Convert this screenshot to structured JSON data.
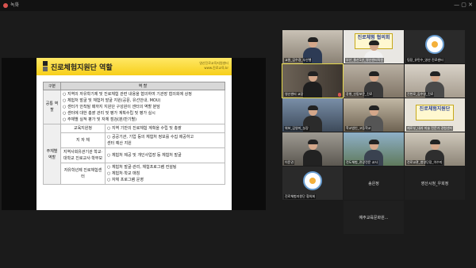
{
  "window": {
    "title": "녹화",
    "window_controls": "— ▢ ✕"
  },
  "slide": {
    "title": "진로체험지원단 역할",
    "org_line1": "영산진로교육지원센터",
    "org_line2": "www.진로교육.kr",
    "col_headers": [
      "구분",
      "역 할"
    ],
    "common": {
      "label": "공통 역할",
      "items": [
        "○ 지역의 자유학기제 및 진로체험 관련 내용을 협의하여 기관장 협의회에 상정",
        "○ 체험처 발굴 및 체험처 발굴 지원(공문, 유선안내, MOU)",
        "○ 센터가 안착될 때까지 지원단 구성원이 센터의 역할 분담",
        "○ 센터에 대한 총괄 관리 및 평가 계획수립 및 평가 실시",
        "○ 주체별 실적 평가 및 자체 점검(분/반기별)"
      ]
    },
    "agency": {
      "label": "주체별 역할",
      "rows": [
        {
          "sub": "교육지원청",
          "items": [
            "○ 지역 기반의 진로체험 계획을 수립 및 총괄"
          ]
        },
        {
          "sub": "지 자 체",
          "items": [
            "○ 공공기관, 기업 등의 체험처 정보를 수집 제공하고",
            "   센터 예산 지원"
          ]
        },
        {
          "sub": "지역사회유관기관 학교·대학교 진로교사·학부모",
          "items": [
            "○ 체험처 제공 및 개인사업장 등 체험처 발굴"
          ]
        },
        {
          "sub": "자유학년제 진로체험센터",
          "items": [
            "○ 체험처 발굴·관리, 체험프로그램 컨설팅",
            "○ 체험처·학교 매칭",
            "○ 자체 프로그램 운영"
          ]
        }
      ]
    }
  },
  "participants": [
    {
      "name": "교원_김수경_부산행",
      "kind": "person"
    },
    {
      "name": "부산_울산1권_영산센터직원",
      "kind": "sign",
      "sign_text": "진로체험 협의회"
    },
    {
      "name": "팀장_유민수_영산 진로센터",
      "kind": "logo"
    },
    {
      "name": "영산센터 교장",
      "kind": "person"
    },
    {
      "name": "장병_신동보문_진로",
      "kind": "person"
    },
    {
      "name": "진천로_김수영_진로",
      "kind": "person"
    },
    {
      "name": "위보_김영미_실장",
      "kind": "person"
    },
    {
      "name": "학교법인_고등학교",
      "kind": "person"
    },
    {
      "name": "제로부_내과 미술 전문가 경험센터",
      "kind": "sign",
      "sign_text": "진로체험지원단"
    },
    {
      "name": "이문권",
      "kind": "person"
    },
    {
      "name": "전도체험_관광전문 교사",
      "kind": "person"
    },
    {
      "name": "전로교관_청영단장_이수미",
      "kind": "person"
    },
    {
      "name": "진로체험지원단 협의회",
      "kind": "logo"
    },
    {
      "name": "송은정",
      "kind": "empty"
    },
    {
      "name": "영산시청_우희정",
      "kind": "empty"
    },
    {
      "name": "예주교육문화원...",
      "kind": "empty"
    }
  ]
}
